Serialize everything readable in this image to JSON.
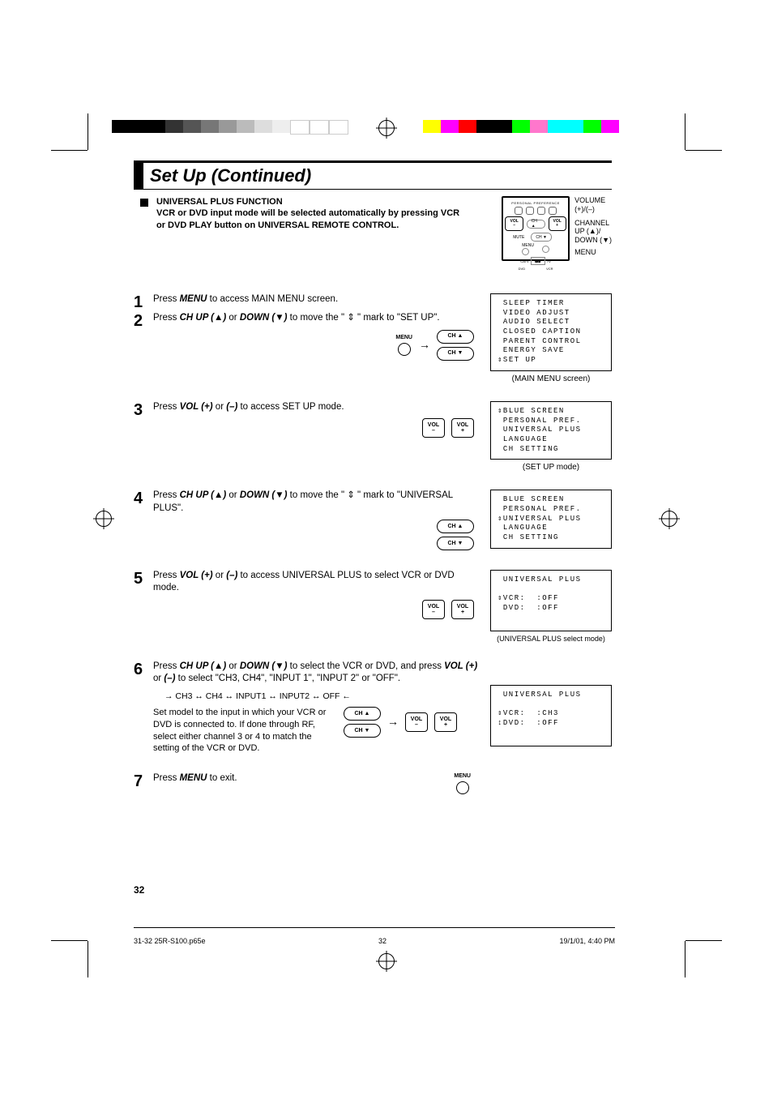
{
  "title": "Set Up (Continued)",
  "intro": {
    "heading": "UNIVERSAL PLUS FUNCTION",
    "body": "VCR or DVD input mode will be selected automatically by pressing VCR or DVD PLAY button on UNIVERSAL REMOTE CONTROL."
  },
  "remote_labels": {
    "volume": "VOLUME",
    "volsign": "(+)/(–)",
    "channel": "CHANNEL",
    "updown": "UP (▲)/\nDOWN (▼)",
    "menu": "MENU",
    "pp": "PERSONAL PREFERENCE",
    "ch_up": "CH ▲",
    "ch_dn": "CH ▼",
    "menu_small": "MENU",
    "vol_minus": "VOL\n–",
    "vol_plus": "VOL\n+",
    "catv": "CATV",
    "tv": "TV",
    "dvd": "DVD",
    "vcr": "VCR",
    "mute": "MUTE"
  },
  "steps": {
    "s1": {
      "num": "1",
      "text_a": "Press ",
      "menu": "MENU",
      "text_b": " to access MAIN MENU screen."
    },
    "s2": {
      "num": "2",
      "text_a": "Press ",
      "chup": "CH UP (▲)",
      "or": " or ",
      "down": "DOWN (▼)",
      "text_b": " to move the \" ⇕ \" mark to \"SET UP\"."
    },
    "s3": {
      "num": "3",
      "text_a": "Press ",
      "volp": "VOL (+)",
      "or": " or ",
      "volm": "(–)",
      "text_b": " to access SET UP mode."
    },
    "s4": {
      "num": "4",
      "text_a": "Press ",
      "chup": "CH UP (▲)",
      "or": " or ",
      "down": "DOWN (▼)",
      "text_b": " to move the \" ⇕ \" mark to \"UNIVERSAL PLUS\"."
    },
    "s5": {
      "num": "5",
      "text_a": "Press ",
      "volp": "VOL (+)",
      "or": " or ",
      "volm": "(–)",
      "text_b": " to access UNIVERSAL PLUS to select VCR or DVD mode."
    },
    "s6": {
      "num": "6",
      "text_a": "Press ",
      "chup": "CH UP (▲)",
      "or": " or ",
      "down": "DOWN (▼)",
      "text_b": " to select the VCR or DVD, and press ",
      "volp": "VOL (+)",
      "or2": " or ",
      "volm": "(–)",
      "text_c": " to select \"CH3, CH4\", \"INPUT 1\", \"INPUT 2\" or \"OFF\".",
      "cycle": "→ CH3 ↔ CH4 ↔ INPUT1 ↔ INPUT2 ↔ OFF ←",
      "note": "Set model to the input in which your VCR or DVD is connected to. If done through RF, select either channel 3 or 4 to match the setting of the VCR or DVD."
    },
    "s7": {
      "num": "7",
      "text_a": "Press ",
      "menu": "MENU",
      "text_b": " to exit."
    }
  },
  "osd": {
    "main_menu": " SLEEP TIMER\n VIDEO ADJUST\n AUDIO SELECT\n CLOSED CAPTION\n PARENT CONTROL\n ENERGY SAVE\n⇕SET UP",
    "main_menu_caption": "(MAIN MENU screen)",
    "setup": "⇕BLUE SCREEN\n PERSONAL PREF.\n UNIVERSAL PLUS\n LANGUAGE\n CH SETTING",
    "setup_caption": "(SET UP mode)",
    "univ_sel": " BLUE SCREEN\n PERSONAL PREF.\n⇕UNIVERSAL PLUS\n LANGUAGE\n CH SETTING",
    "univ_plus_off": " UNIVERSAL PLUS\n\n⇕VCR:  :OFF\n DVD:  :OFF",
    "univ_plus_off_caption": "(UNIVERSAL PLUS select mode)",
    "univ_plus_ch3": " UNIVERSAL PLUS\n\n⇕VCR:  :CH3\n↕DVD:  :OFF"
  },
  "buttons": {
    "menu": "MENU",
    "ch_up": "CH ▲",
    "ch_dn": "CH ▼",
    "vol_minus_top": "VOL",
    "vol_minus_bot": "–",
    "vol_plus_top": "VOL",
    "vol_plus_bot": "+"
  },
  "page_number": "32",
  "footer": {
    "file": "31-32 25R-S100.p65e",
    "page": "32",
    "date": "19/1/01, 4:40 PM"
  }
}
